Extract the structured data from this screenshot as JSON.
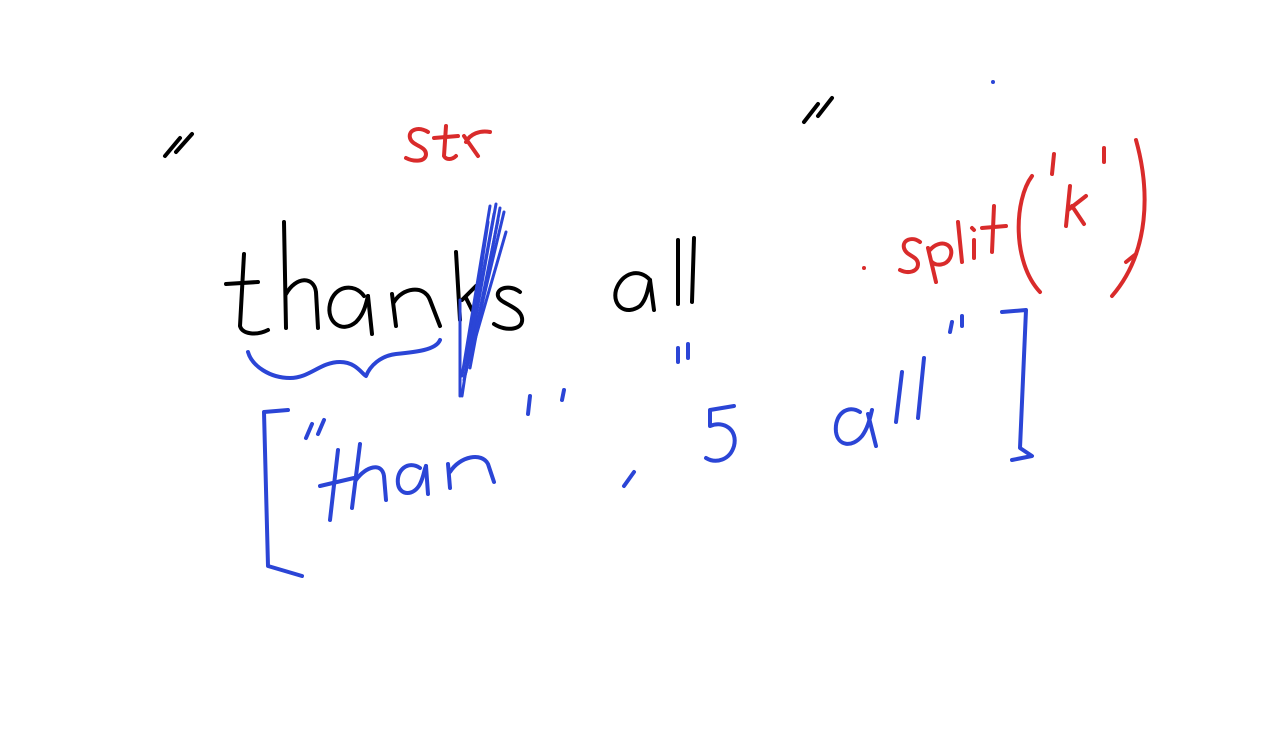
{
  "colors": {
    "background": "#ffffff",
    "black_ink": "#000000",
    "red_ink": "#d92b2b",
    "blue_ink": "#2b45d6"
  },
  "strokes": {
    "source_string": "thanks all",
    "type_label": "str",
    "method_call": "split('k')",
    "result_list": "[\"than\", \"s all\"]"
  }
}
